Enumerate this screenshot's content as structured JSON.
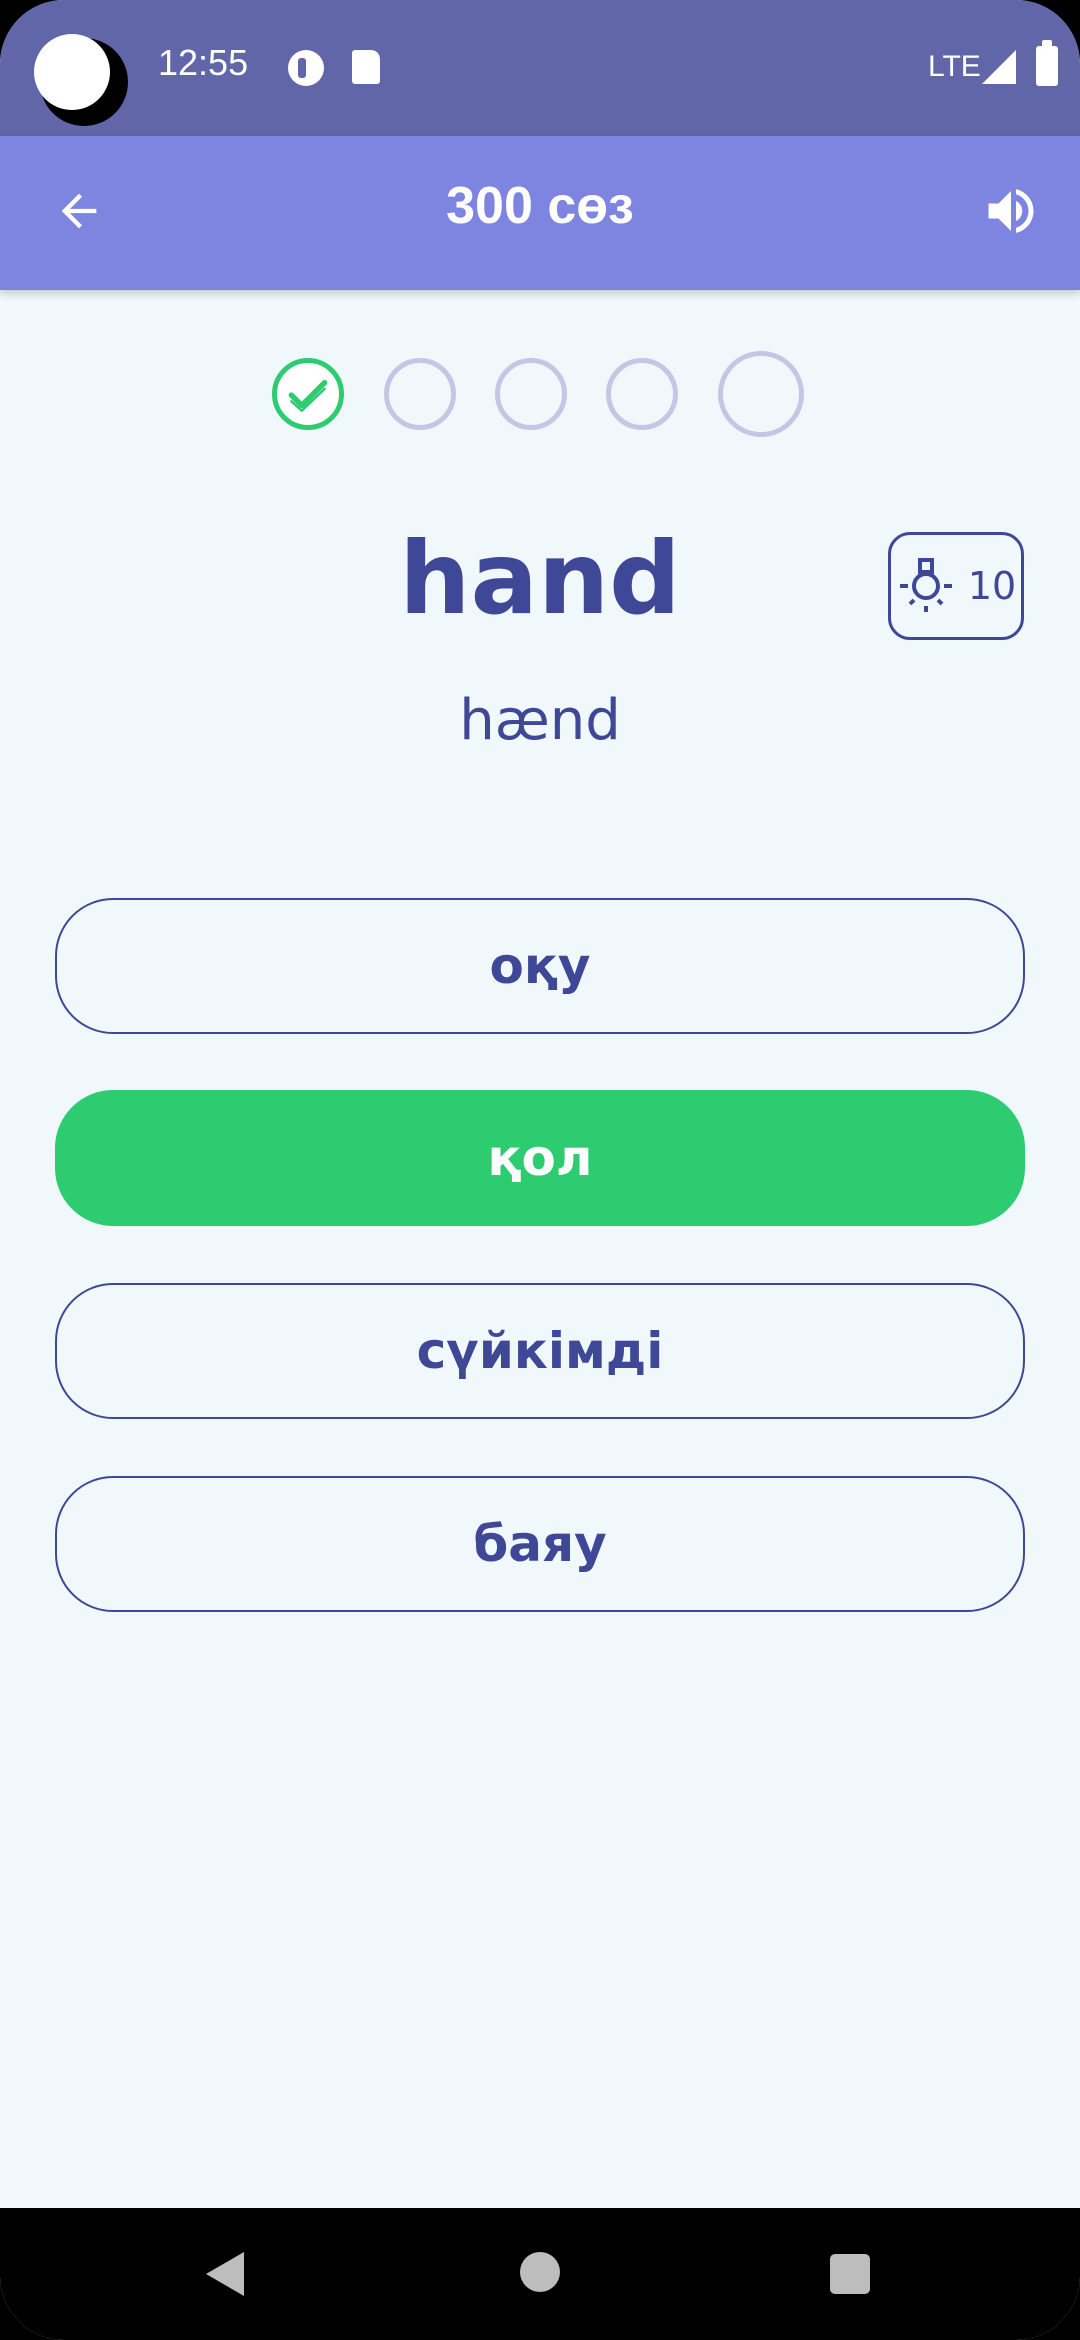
{
  "status_bar": {
    "time": "12:55",
    "network": "LTE"
  },
  "app_bar": {
    "title": "300 сөз"
  },
  "progress": {
    "total": 5,
    "completed": 1,
    "current_index": 4
  },
  "word": {
    "text": "hand",
    "transcription": "hænd"
  },
  "hint": {
    "count": "10"
  },
  "options": [
    {
      "label": "оқу",
      "state": "default"
    },
    {
      "label": "қол",
      "state": "correct"
    },
    {
      "label": "сүйкімді",
      "state": "default"
    },
    {
      "label": "баяу",
      "state": "default"
    }
  ],
  "colors": {
    "app_bar": "#7D85E1",
    "status_bar": "#6066A8",
    "accent_text": "#3F4896",
    "correct": "#2ECC71",
    "background": "#F0F8FB"
  },
  "icons": [
    "back-arrow-icon",
    "volume-icon",
    "check-icon",
    "lightbulb-icon"
  ]
}
